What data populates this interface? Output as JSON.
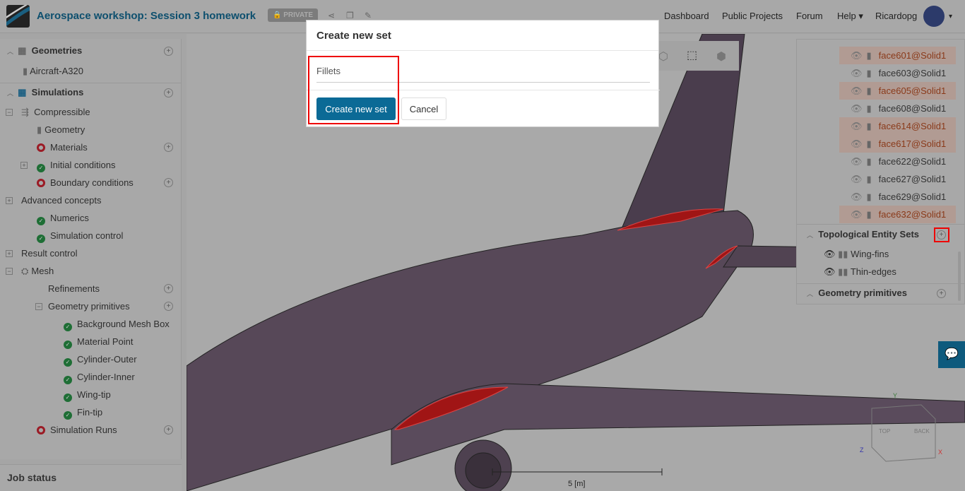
{
  "header": {
    "title": "Aerospace workshop: Session 3 homework",
    "privacy_badge": "PRIVATE",
    "nav": [
      "Dashboard",
      "Public Projects",
      "Forum",
      "Help"
    ],
    "user": "Ricardopg"
  },
  "tree": {
    "geometries": {
      "label": "Geometries",
      "items": [
        "Aircraft-A320"
      ]
    },
    "simulations": {
      "label": "Simulations",
      "analysis": "Compressible",
      "items": [
        {
          "label": "Geometry",
          "status": "ok"
        },
        {
          "label": "Materials",
          "status": "error"
        },
        {
          "label": "Initial conditions",
          "status": "ok"
        },
        {
          "label": "Boundary conditions",
          "status": "error"
        },
        {
          "label": "Advanced concepts",
          "status": "none"
        },
        {
          "label": "Numerics",
          "status": "ok"
        },
        {
          "label": "Simulation control",
          "status": "ok"
        },
        {
          "label": "Result control",
          "status": "none"
        },
        {
          "label": "Mesh",
          "status": "mesh"
        },
        {
          "label": "Refinements",
          "status": "none"
        },
        {
          "label": "Geometry primitives",
          "status": "none"
        },
        {
          "label": "Background Mesh Box",
          "status": "ok"
        },
        {
          "label": "Material Point",
          "status": "ok"
        },
        {
          "label": "Cylinder-Outer",
          "status": "ok"
        },
        {
          "label": "Cylinder-Inner",
          "status": "ok"
        },
        {
          "label": "Wing-tip",
          "status": "ok"
        },
        {
          "label": "Fin-tip",
          "status": "ok"
        },
        {
          "label": "Simulation Runs",
          "status": "error"
        }
      ]
    }
  },
  "job_status": "Job status",
  "right_panel": {
    "faces": [
      {
        "label": "face601@Solid1",
        "selected": true
      },
      {
        "label": "face603@Solid1",
        "selected": false
      },
      {
        "label": "face605@Solid1",
        "selected": true
      },
      {
        "label": "face608@Solid1",
        "selected": false
      },
      {
        "label": "face614@Solid1",
        "selected": true
      },
      {
        "label": "face617@Solid1",
        "selected": true
      },
      {
        "label": "face622@Solid1",
        "selected": false
      },
      {
        "label": "face627@Solid1",
        "selected": false
      },
      {
        "label": "face629@Solid1",
        "selected": false
      },
      {
        "label": "face632@Solid1",
        "selected": true
      }
    ],
    "topo_sets": {
      "label": "Topological Entity Sets",
      "items": [
        "Wing-fins",
        "Thin-edges"
      ]
    },
    "geometry_primitives": "Geometry primitives"
  },
  "modal": {
    "title": "Create new set",
    "input_value": "Fillets",
    "create_label": "Create new set",
    "cancel_label": "Cancel"
  },
  "viewport": {
    "scale_label": "5 [m]",
    "cube_top": "TOP",
    "cube_back": "BACK",
    "axis_x": "X",
    "axis_y": "Y",
    "axis_z": "Z"
  }
}
